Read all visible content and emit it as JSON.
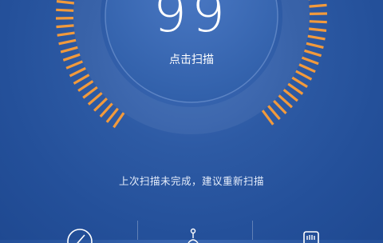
{
  "gauge": {
    "score": "99",
    "tick_color": "#f29a3c",
    "ring_color": "#5f86c7"
  },
  "scan_button": {
    "label": "点击扫描"
  },
  "status": {
    "message": "上次扫描未完成，建议重新扫描"
  },
  "bottom_tools": [
    {
      "icon": "compass-icon"
    },
    {
      "icon": "broom-icon"
    },
    {
      "icon": "hand-shield-icon"
    }
  ]
}
